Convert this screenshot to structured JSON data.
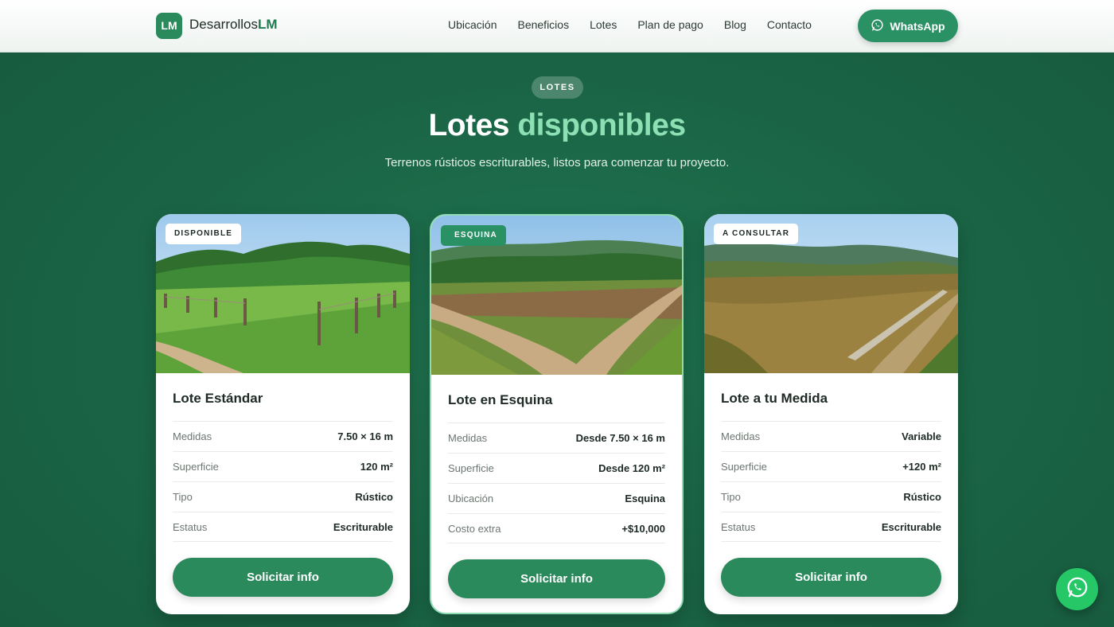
{
  "header": {
    "logo_badge": "LM",
    "logo_text": "Desarrollos",
    "logo_text_strong": "LM",
    "nav": [
      "Ubicación",
      "Beneficios",
      "Lotes",
      "Plan de pago",
      "Blog",
      "Contacto"
    ],
    "whatsapp_label": "WhatsApp"
  },
  "section": {
    "pill": "LOTES",
    "title": "Lotes",
    "title_accent": "disponibles",
    "subtitle": "Terrenos rústicos escriturables, listos para comenzar tu proyecto."
  },
  "cards": [
    {
      "badge": "DISPONIBLE",
      "title": "Lote Estándar",
      "rows": [
        {
          "k": "Medidas",
          "v": "7.50 × 16 m"
        },
        {
          "k": "Superficie",
          "v": "120 m²"
        },
        {
          "k": "Tipo",
          "v": "Rústico"
        },
        {
          "k": "Estatus",
          "v": "Escriturable"
        }
      ],
      "cta": "Solicitar info"
    },
    {
      "badge": "ESQUINA",
      "title": "Lote en Esquina",
      "rows": [
        {
          "k": "Medidas",
          "v": "Desde 7.50 × 16 m"
        },
        {
          "k": "Superficie",
          "v": "Desde 120 m²"
        },
        {
          "k": "Ubicación",
          "v": "Esquina"
        },
        {
          "k": "Costo extra",
          "v": "+$10,000"
        }
      ],
      "cta": "Solicitar info"
    },
    {
      "badge": "A CONSULTAR",
      "title": "Lote a tu Medida",
      "rows": [
        {
          "k": "Medidas",
          "v": "Variable"
        },
        {
          "k": "Superficie",
          "v": "+120 m²"
        },
        {
          "k": "Tipo",
          "v": "Rústico"
        },
        {
          "k": "Estatus",
          "v": "Escriturable"
        }
      ],
      "cta": "Solicitar info"
    }
  ],
  "colors": {
    "brand": "#2a8a5c",
    "accent": "#8de0b4",
    "whatsapp": "#26c766"
  },
  "icons": {
    "header_whatsapp": "whatsapp-icon",
    "floating": "whatsapp-icon"
  }
}
